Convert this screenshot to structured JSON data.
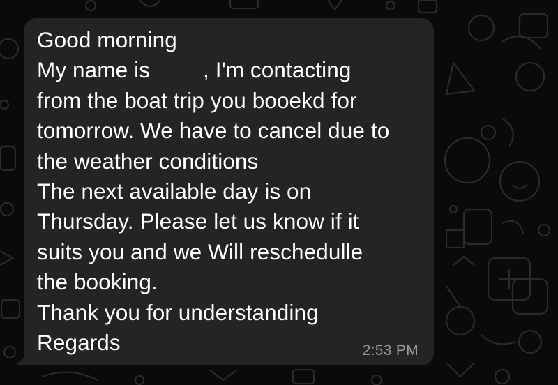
{
  "message": {
    "line_1": "Good morning",
    "line_2_before_name": "My name is",
    "line_2_after_name": ", I'm contacting",
    "line_3": "from the boat trip you booekd for",
    "line_4": "tomorrow. We have to cancel due to",
    "line_5": "the weather conditions",
    "line_6": "The next available day is on",
    "line_7": "Thursday. Please let us know if it",
    "line_8": "suits you and we Will reschedulle",
    "line_9": "the booking.",
    "line_10": "Thank you for understanding",
    "line_11": "Regards",
    "timestamp": "2:53 PM"
  },
  "colors": {
    "background": "#0a0a0a",
    "bubble": "#242424",
    "text": "#ffffff",
    "timestamp": "#9a9a9a",
    "doodle": "#2a2a2a"
  },
  "icons": [
    "doodle-wallpaper-icon"
  ]
}
